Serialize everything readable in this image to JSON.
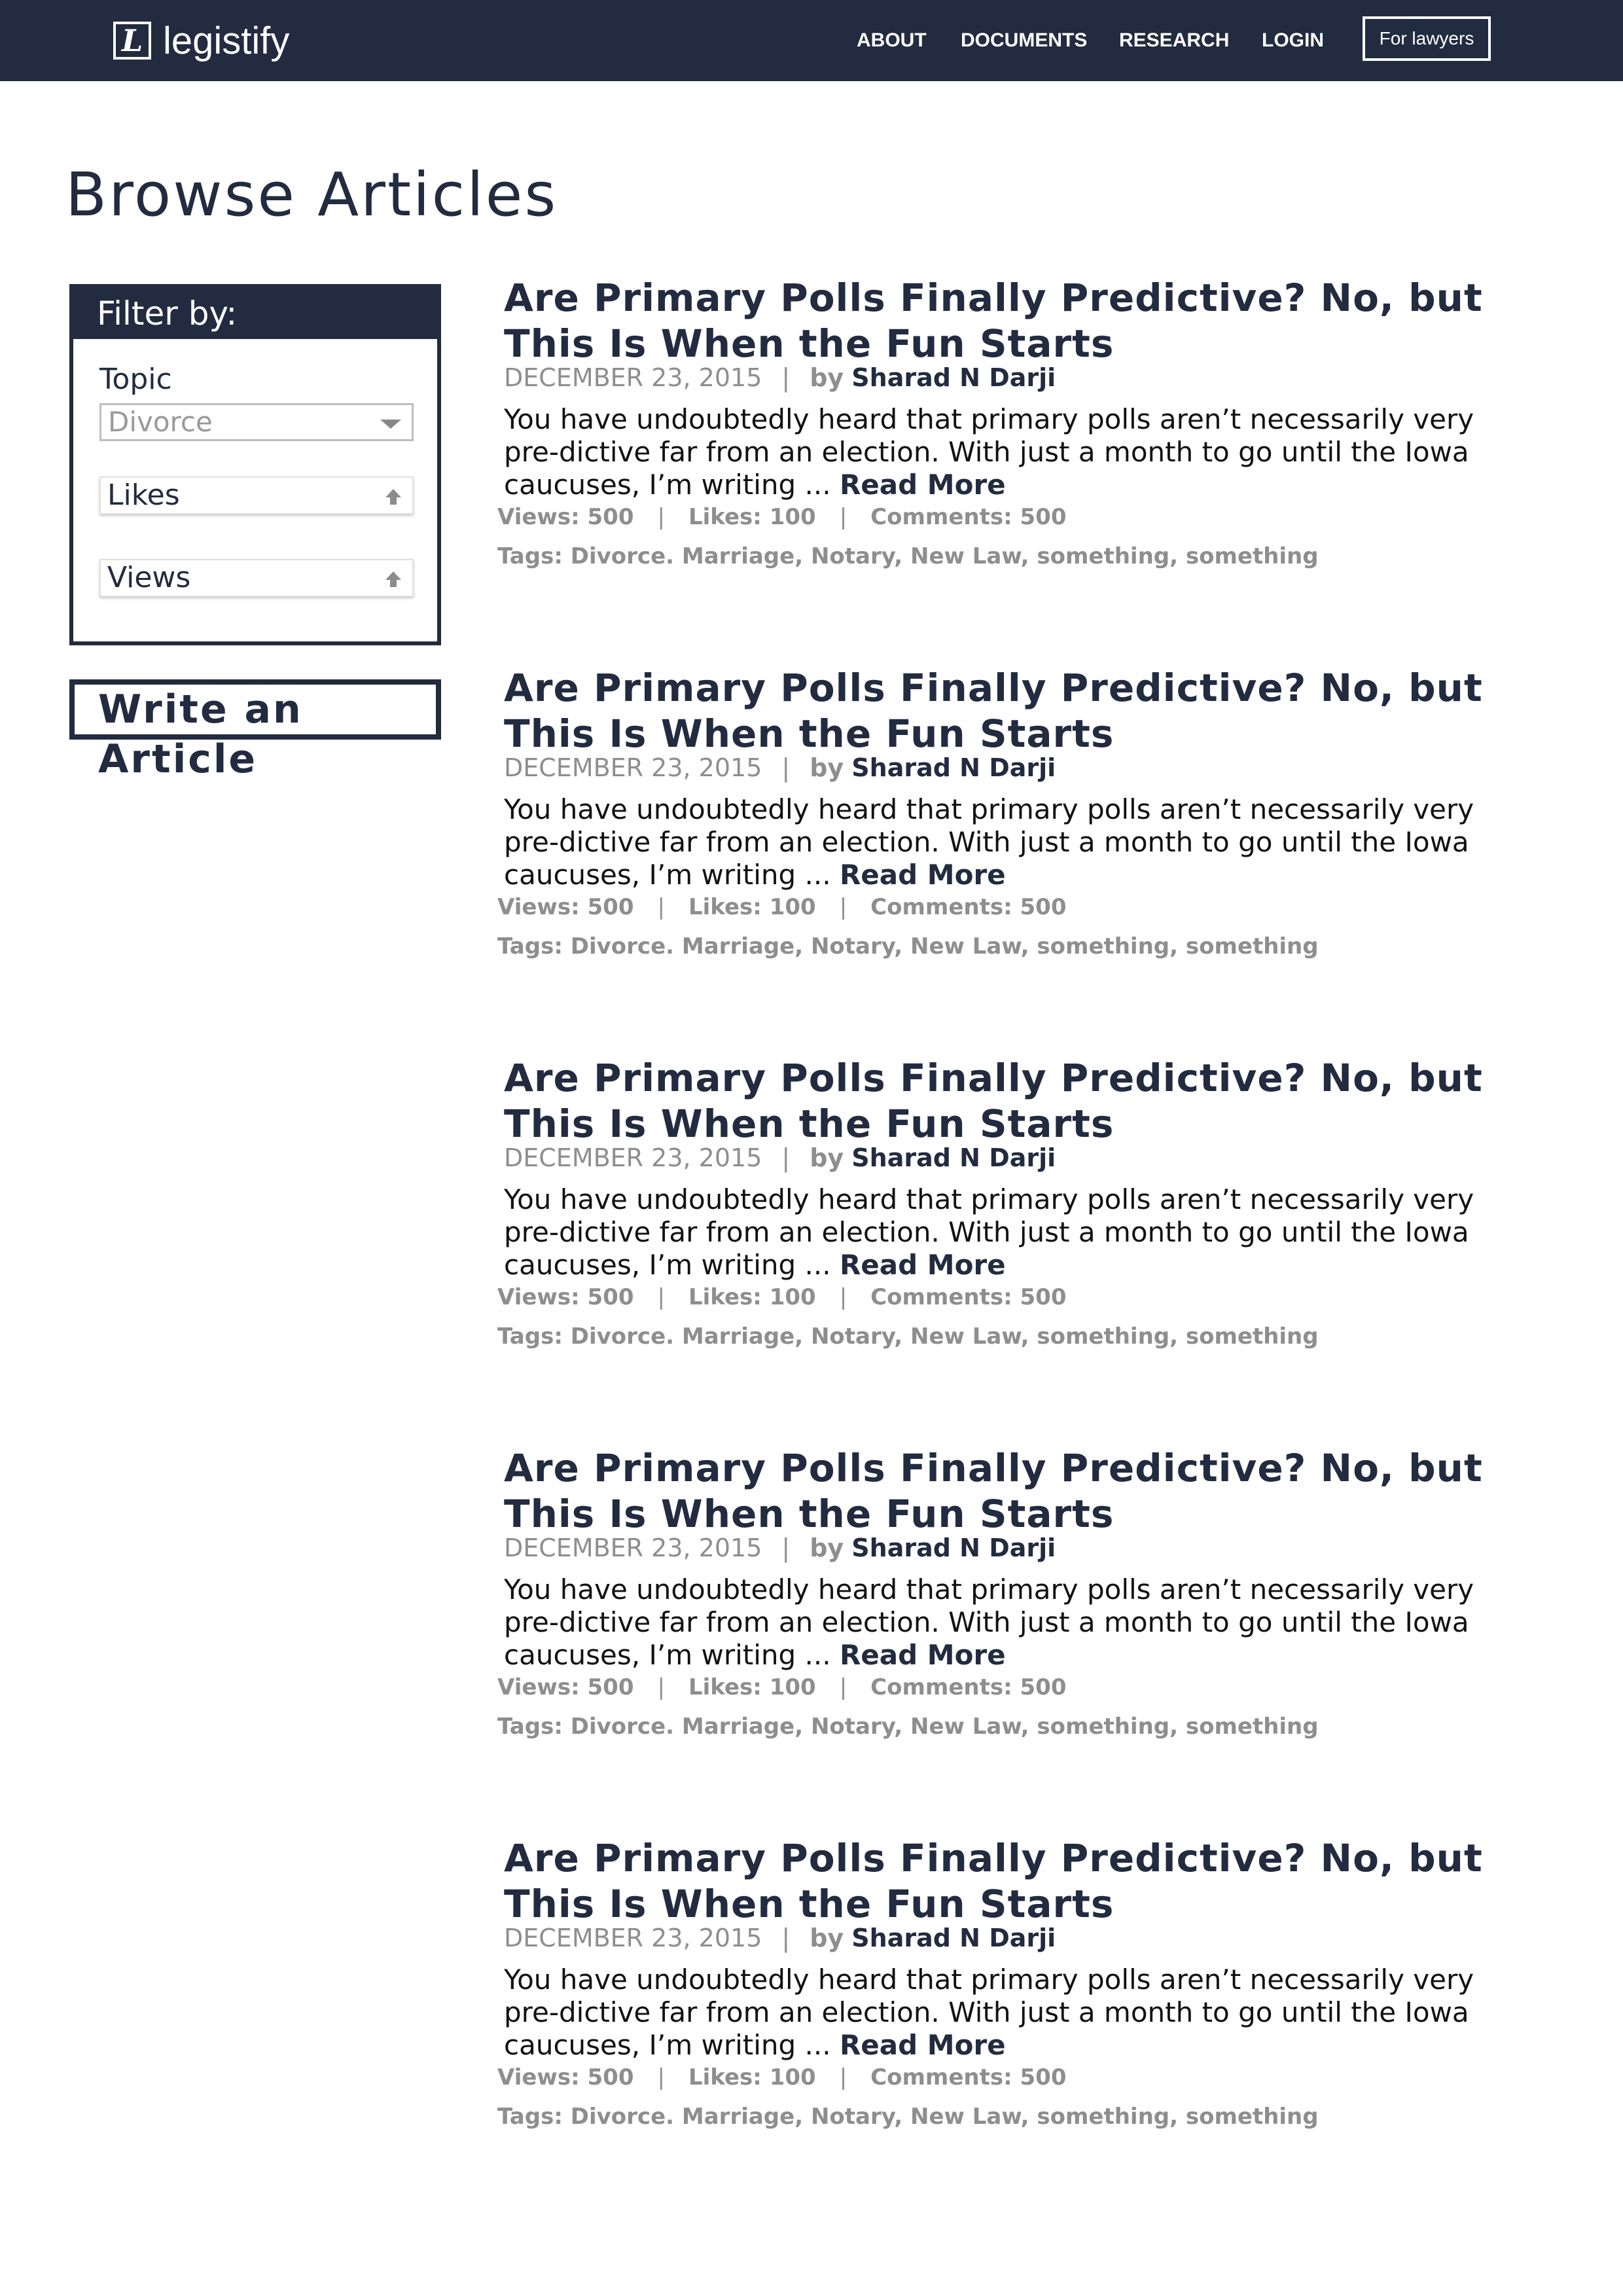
{
  "nav": {
    "logo_letter": "L",
    "logo_text": "legistify",
    "links": [
      "ABOUT",
      "DOCUMENTS",
      "RESEARCH",
      "LOGIN"
    ],
    "cta_label": "For lawyers"
  },
  "page": {
    "title": "Browse Articles"
  },
  "filter": {
    "header": "Filter by:",
    "topic_label": "Topic",
    "topic_value": "Divorce",
    "likes_label": "Likes",
    "views_label": "Views",
    "sort_icon": "arrow-up-icon"
  },
  "write_article": {
    "label": "Write an Article"
  },
  "articles": [
    {
      "title": "Are Primary Polls Finally Predictive? No, but This Is When the Fun Starts",
      "date": "DECEMBER 23, 2015",
      "separator": "|",
      "by": "by",
      "author": "Sharad N Darji",
      "excerpt": "You have undoubtedly heard that primary polls aren’t necessarily very pre-dictive far from an election. With just a month to go until the Iowa caucuses, I’m writing ...",
      "read_more": "Read More",
      "views": "Views: 500",
      "likes": "Likes: 100",
      "comments": "Comments: 500",
      "tags": "Tags: Divorce. Marriage, Notary, New Law, something, something"
    },
    {
      "title": "Are Primary Polls Finally Predictive? No, but This Is When the Fun Starts",
      "date": "DECEMBER 23, 2015",
      "separator": "|",
      "by": "by",
      "author": "Sharad N Darji",
      "excerpt": "You have undoubtedly heard that primary polls aren’t necessarily very pre-dictive far from an election. With just a month to go until the Iowa caucuses, I’m writing ...",
      "read_more": "Read More",
      "views": "Views: 500",
      "likes": "Likes: 100",
      "comments": "Comments: 500",
      "tags": "Tags: Divorce. Marriage, Notary, New Law, something, something"
    },
    {
      "title": "Are Primary Polls Finally Predictive? No, but This Is When the Fun Starts",
      "date": "DECEMBER 23, 2015",
      "separator": "|",
      "by": "by",
      "author": "Sharad N Darji",
      "excerpt": "You have undoubtedly heard that primary polls aren’t necessarily very pre-dictive far from an election. With just a month to go until the Iowa caucuses, I’m writing ...",
      "read_more": "Read More",
      "views": "Views: 500",
      "likes": "Likes: 100",
      "comments": "Comments: 500",
      "tags": "Tags: Divorce. Marriage, Notary, New Law, something, something"
    },
    {
      "title": "Are Primary Polls Finally Predictive? No, but This Is When the Fun Starts",
      "date": "DECEMBER 23, 2015",
      "separator": "|",
      "by": "by",
      "author": "Sharad N Darji",
      "excerpt": "You have undoubtedly heard that primary polls aren’t necessarily very pre-dictive far from an election. With just a month to go until the Iowa caucuses, I’m writing ...",
      "read_more": "Read More",
      "views": "Views: 500",
      "likes": "Likes: 100",
      "comments": "Comments: 500",
      "tags": "Tags: Divorce. Marriage, Notary, New Law, something, something"
    },
    {
      "title": "Are Primary Polls Finally Predictive? No, but This Is When the Fun Starts",
      "date": "DECEMBER 23, 2015",
      "separator": "|",
      "by": "by",
      "author": "Sharad N Darji",
      "excerpt": "You have undoubtedly heard that primary polls aren’t necessarily very pre-dictive far from an election. With just a month to go until the Iowa caucuses, I’m writing ...",
      "read_more": "Read More",
      "views": "Views: 500",
      "likes": "Likes: 100",
      "comments": "Comments: 500",
      "tags": "Tags: Divorce. Marriage, Notary, New Law, something, something"
    }
  ],
  "colors": {
    "navy": "#222b3f",
    "muted_text": "#8e8e8e",
    "border_gray": "#bdbdbd"
  }
}
